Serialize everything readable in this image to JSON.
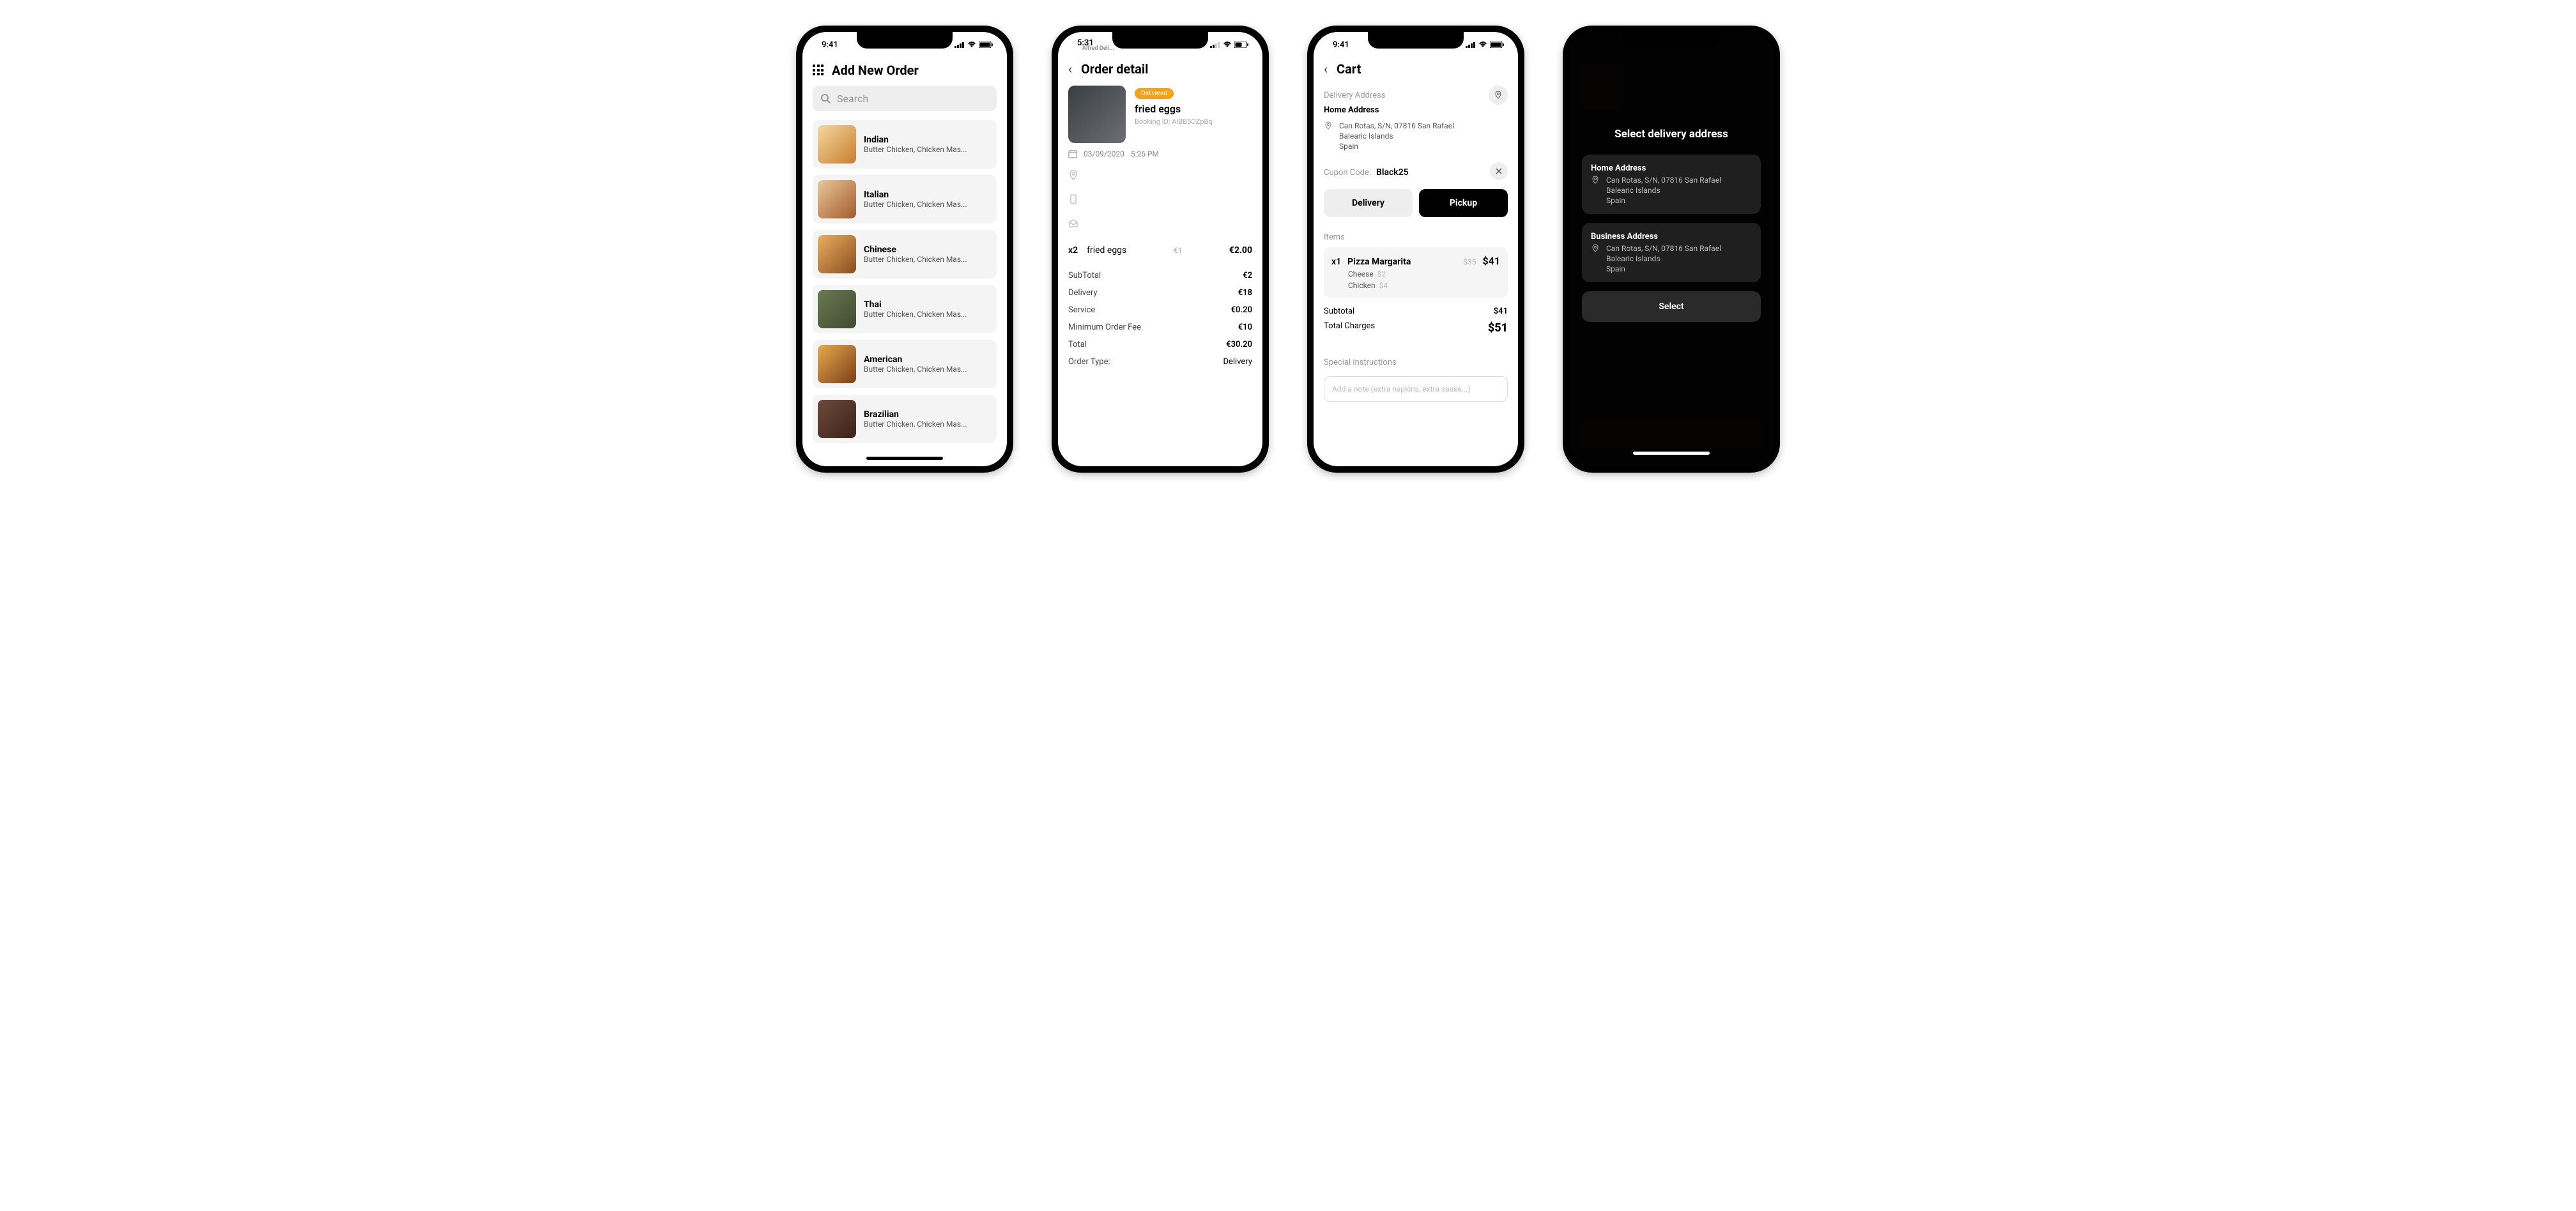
{
  "status": {
    "time_a": "9:41",
    "time_b": "5:31",
    "carrier_back": "Alfred Deli..."
  },
  "screen1": {
    "title": "Add New Order",
    "search_placeholder": "Search",
    "categories": [
      {
        "name": "Indian",
        "sub": "Butter Chicken, Chicken Mas..."
      },
      {
        "name": "Italian",
        "sub": "Butter Chicken, Chicken Mas..."
      },
      {
        "name": "Chinese",
        "sub": "Butter Chicken, Chicken Mas..."
      },
      {
        "name": "Thai",
        "sub": "Butter Chicken, Chicken Mas..."
      },
      {
        "name": "American",
        "sub": "Butter Chicken, Chicken Mas..."
      },
      {
        "name": "Brazilian",
        "sub": "Butter Chicken, Chicken Mas..."
      }
    ]
  },
  "screen2": {
    "title": "Order detail",
    "badge": "Delivered",
    "item_name": "fried eggs",
    "booking_label": "Booking ID:",
    "booking_id": "AIBB5OZpBq",
    "date": "03/09/2020",
    "time": "5:26 PM",
    "line": {
      "qty": "x2",
      "name": "fried eggs",
      "unit": "€1",
      "total": "€2.00"
    },
    "totals": [
      {
        "k": "SubTotal",
        "v": "€2"
      },
      {
        "k": "Delivery",
        "v": "€18"
      },
      {
        "k": "Service",
        "v": "€0.20"
      },
      {
        "k": "Minimum Order Fee",
        "v": "€10"
      },
      {
        "k": "Total",
        "v": "€30.20"
      },
      {
        "k": "Order Type:",
        "v": "Delivery"
      }
    ]
  },
  "screen3": {
    "title": "Cart",
    "addr_section": "Delivery Address",
    "addr_name": "Home Address",
    "addr_lines": [
      "Can Rotas, S/N, 07816 San Rafael",
      "Balearic Islands",
      "Spain"
    ],
    "coupon_label": "Cupon Code:",
    "coupon_value": "Black25",
    "delivery_btn": "Delivery",
    "pickup_btn": "Pickup",
    "items_label": "Items",
    "item": {
      "qty": "x1",
      "name": "Pizza Margarita",
      "base": "$35",
      "total": "$41",
      "addons": [
        {
          "n": "Cheese",
          "p": "$2"
        },
        {
          "n": "Chicken",
          "p": "$4"
        }
      ]
    },
    "subtotal_label": "Subtotal",
    "subtotal_value": "$41",
    "total_label": "Total Charges",
    "total_value": "$51",
    "special_label": "Special instructions",
    "note_placeholder": "Add a note (extra napkins, extra sause...)"
  },
  "screen4": {
    "modal_title": "Select delivery address",
    "addresses": [
      {
        "name": "Home Address",
        "lines": [
          "Can Rotas, S/N, 07816 San Rafael",
          "Balearic Islands",
          "Spain"
        ]
      },
      {
        "name": "Business Address",
        "lines": [
          "Can Rotas, S/N, 07816 San Rafael",
          "Balearic Islands",
          "Spain"
        ]
      }
    ],
    "select_btn": "Select"
  }
}
